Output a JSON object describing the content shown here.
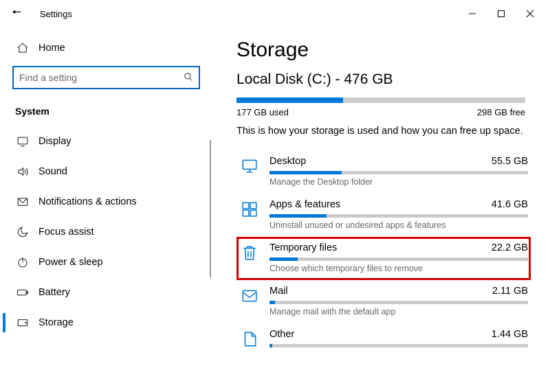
{
  "window": {
    "title": "Settings"
  },
  "sidebar": {
    "home": "Home",
    "search_placeholder": "Find a setting",
    "section": "System",
    "items": [
      {
        "label": "Display"
      },
      {
        "label": "Sound"
      },
      {
        "label": "Notifications & actions"
      },
      {
        "label": "Focus assist"
      },
      {
        "label": "Power & sleep"
      },
      {
        "label": "Battery"
      },
      {
        "label": "Storage"
      }
    ]
  },
  "main": {
    "heading": "Storage",
    "disk_title": "Local Disk (C:) - 476 GB",
    "disk_used": "177 GB used",
    "disk_free": "298 GB free",
    "disk_fill_percent": 37,
    "description": "This is how your storage is used and how you can free up space.",
    "categories": [
      {
        "name": "Desktop",
        "size": "55.5 GB",
        "subtitle": "Manage the Desktop folder",
        "fill": 28
      },
      {
        "name": "Apps & features",
        "size": "41.6 GB",
        "subtitle": "Uninstall unused or undesired apps & features",
        "fill": 22
      },
      {
        "name": "Temporary files",
        "size": "22.2 GB",
        "subtitle": "Choose which temporary files to remove",
        "fill": 11
      },
      {
        "name": "Mail",
        "size": "2.11 GB",
        "subtitle": "Manage mail with the default app",
        "fill": 2
      },
      {
        "name": "Other",
        "size": "1.44 GB",
        "subtitle": "",
        "fill": 1
      }
    ]
  }
}
